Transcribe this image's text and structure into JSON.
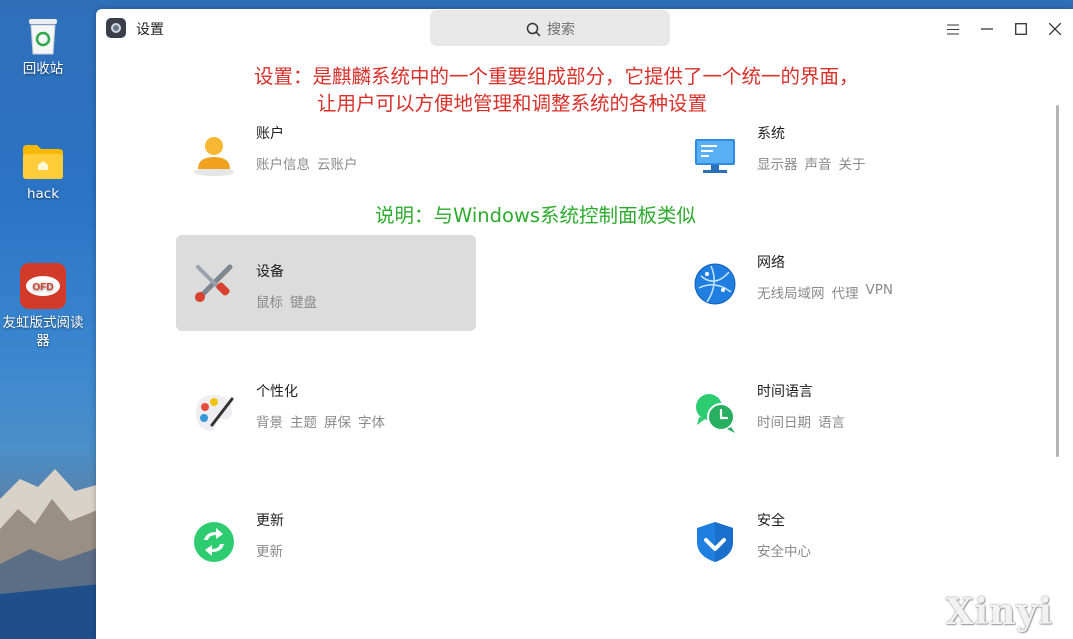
{
  "desktop": {
    "icons": [
      {
        "label": "回收站"
      },
      {
        "label": "hack"
      },
      {
        "label": "友虹版式阅读器"
      }
    ]
  },
  "window": {
    "title": "设置",
    "search_placeholder": "搜索"
  },
  "annotations": {
    "line1": "设置：是麒麟系统中的一个重要组成部分，它提供了一个统一的界面，",
    "line2": "让用户可以方便地管理和调整系统的各种设置",
    "note": "说明：与Windows系统控制面板类似"
  },
  "categories": [
    {
      "title": "账户",
      "subs": [
        "账户信息",
        "云账户"
      ],
      "icon": "account-icon"
    },
    {
      "title": "系统",
      "subs": [
        "显示器",
        "声音",
        "关于"
      ],
      "icon": "monitor-icon"
    },
    {
      "title": "设备",
      "subs": [
        "鼠标",
        "键盘"
      ],
      "icon": "tools-icon"
    },
    {
      "title": "网络",
      "subs": [
        "无线局域网",
        "代理",
        "VPN"
      ],
      "icon": "globe-icon"
    },
    {
      "title": "个性化",
      "subs": [
        "背景",
        "主题",
        "屏保",
        "字体"
      ],
      "icon": "palette-icon"
    },
    {
      "title": "时间语言",
      "subs": [
        "时间日期",
        "语言"
      ],
      "icon": "clock-chat-icon"
    },
    {
      "title": "更新",
      "subs": [
        "更新"
      ],
      "icon": "update-icon"
    },
    {
      "title": "安全",
      "subs": [
        "安全中心"
      ],
      "icon": "shield-icon"
    }
  ],
  "watermark": "Xinyi",
  "colors": {
    "annotation_red": "#d9302a",
    "annotation_green": "#2dab2d",
    "hover": "#dcdcdc"
  }
}
